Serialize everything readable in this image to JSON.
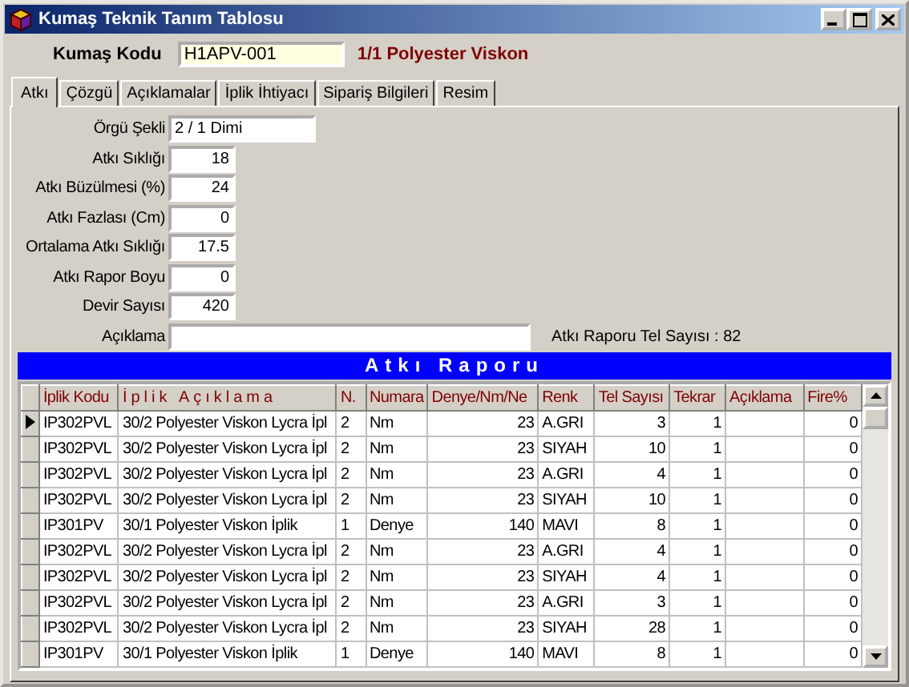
{
  "window": {
    "title": "Kumaş Teknik Tanım Tablosu"
  },
  "header": {
    "label": "Kumaş Kodu",
    "value": "H1APV-001",
    "description": "1/1 Polyester Viskon"
  },
  "tabs": [
    {
      "label": "Atkı",
      "selected": true
    },
    {
      "label": "Çözgü",
      "selected": false
    },
    {
      "label": "Açıklamalar",
      "selected": false
    },
    {
      "label": "İplik İhtiyacı",
      "selected": false
    },
    {
      "label": "Sipariş Bilgileri",
      "selected": false
    },
    {
      "label": "Resim",
      "selected": false
    }
  ],
  "form": [
    {
      "label": "Örgü Şekli",
      "value": "2 / 1 Dimi",
      "kind": "wide"
    },
    {
      "label": "Atkı Sıklığı",
      "value": "18",
      "kind": "number"
    },
    {
      "label": "Atkı Büzülmesi (%)",
      "value": "24",
      "kind": "number"
    },
    {
      "label": "Atkı Fazlası (Cm)",
      "value": "0",
      "kind": "number"
    },
    {
      "label": "Ortalama Atkı Sıklığı",
      "value": "17.5",
      "kind": "number"
    },
    {
      "label": "Atkı Rapor Boyu",
      "value": "0",
      "kind": "number"
    },
    {
      "label": "Devir Sayısı",
      "value": "420",
      "kind": "number"
    },
    {
      "label": "Açıklama",
      "kind": "long"
    }
  ],
  "tel_sayisi": "Atkı Raporu Tel Sayısı : 82",
  "report": {
    "title": "Atkı Raporu",
    "columns": [
      {
        "label": "İplik Kodu",
        "kind": "text"
      },
      {
        "label": "İplik Açıklama",
        "kind": "spaced"
      },
      {
        "label": "N.",
        "kind": "text"
      },
      {
        "label": "Numara",
        "kind": "text"
      },
      {
        "label": "Denye/Nm/Ne",
        "kind": "number"
      },
      {
        "label": "Renk",
        "kind": "text"
      },
      {
        "label": "Tel Sayısı",
        "kind": "number"
      },
      {
        "label": "Tekrar",
        "kind": "number"
      },
      {
        "label": "Açıklama",
        "kind": "text"
      },
      {
        "label": "Fire%",
        "kind": "number"
      }
    ],
    "rows": [
      {
        "selected": true,
        "cells": [
          "IP302PVL",
          "30/2 Polyester Viskon Lycra İpl",
          "2",
          "Nm",
          "23",
          "A.GRI",
          "3",
          "1",
          null,
          "0"
        ]
      },
      {
        "selected": false,
        "cells": [
          "IP302PVL",
          "30/2 Polyester Viskon Lycra İpl",
          "2",
          "Nm",
          "23",
          "SIYAH",
          "10",
          "1",
          null,
          "0"
        ]
      },
      {
        "selected": false,
        "cells": [
          "IP302PVL",
          "30/2 Polyester Viskon Lycra İpl",
          "2",
          "Nm",
          "23",
          "A.GRI",
          "4",
          "1",
          null,
          "0"
        ]
      },
      {
        "selected": false,
        "cells": [
          "IP302PVL",
          "30/2 Polyester Viskon Lycra İpl",
          "2",
          "Nm",
          "23",
          "SIYAH",
          "10",
          "1",
          null,
          "0"
        ]
      },
      {
        "selected": false,
        "cells": [
          "IP301PV",
          "30/1 Polyester Viskon İplik",
          "1",
          "Denye",
          "140",
          "MAVI",
          "8",
          "1",
          null,
          "0"
        ]
      },
      {
        "selected": false,
        "cells": [
          "IP302PVL",
          "30/2 Polyester Viskon Lycra İpl",
          "2",
          "Nm",
          "23",
          "A.GRI",
          "4",
          "1",
          null,
          "0"
        ]
      },
      {
        "selected": false,
        "cells": [
          "IP302PVL",
          "30/2 Polyester Viskon Lycra İpl",
          "2",
          "Nm",
          "23",
          "SIYAH",
          "4",
          "1",
          null,
          "0"
        ]
      },
      {
        "selected": false,
        "cells": [
          "IP302PVL",
          "30/2 Polyester Viskon Lycra İpl",
          "2",
          "Nm",
          "23",
          "A.GRI",
          "3",
          "1",
          null,
          "0"
        ]
      },
      {
        "selected": false,
        "cells": [
          "IP302PVL",
          "30/2 Polyester Viskon Lycra İpl",
          "2",
          "Nm",
          "23",
          "SIYAH",
          "28",
          "1",
          null,
          "0"
        ]
      },
      {
        "selected": false,
        "cells": [
          "IP301PV",
          "30/1 Polyester Viskon İplik",
          "1",
          "Denye",
          "140",
          "MAVI",
          "8",
          "1",
          null,
          "0"
        ]
      }
    ]
  }
}
